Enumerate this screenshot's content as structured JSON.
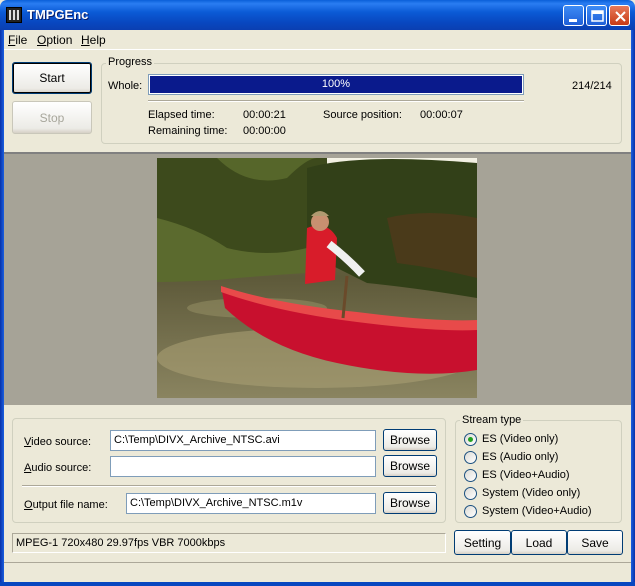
{
  "window": {
    "title": "TMPGEnc"
  },
  "menu": [
    {
      "label": "File",
      "underline": "F",
      "rest": "ile"
    },
    {
      "label": "Option",
      "underline": "O",
      "rest": "ption"
    },
    {
      "label": "Help",
      "underline": "H",
      "rest": "elp"
    }
  ],
  "controls": {
    "start_label": "Start",
    "stop_label": "Stop"
  },
  "progress": {
    "title": "Progress",
    "whole_label": "Whole:",
    "percent_text": "100%",
    "fraction": 1.0,
    "count": "214/214",
    "elapsed_label": "Elapsed time:",
    "elapsed_value": "00:00:21",
    "remaining_label": "Remaining time:",
    "remaining_value": "00:00:00",
    "source_pos_label": "Source position:",
    "source_pos_value": "00:00:07"
  },
  "sources": {
    "video_label_u": "V",
    "video_label_rest": "ideo source:",
    "video_value": "C:\\Temp\\DIVX_Archive_NTSC.avi",
    "audio_label_u": "A",
    "audio_label_rest": "udio source:",
    "audio_value": "",
    "output_label_u": "O",
    "output_label_rest": "utput file name:",
    "output_value": "C:\\Temp\\DIVX_Archive_NTSC.m1v",
    "browse_label": "Browse"
  },
  "stream_type": {
    "title": "Stream type",
    "options": [
      {
        "label": "ES (Video only)",
        "checked": true
      },
      {
        "label": "ES (Audio only)",
        "checked": false
      },
      {
        "label": "ES (Video+Audio)",
        "checked": false
      },
      {
        "label": "System (Video only)",
        "checked": false
      },
      {
        "label": "System (Video+Audio)",
        "checked": false
      }
    ]
  },
  "status": {
    "format_text": "MPEG-1 720x480 29.97fps VBR 7000kbps"
  },
  "bottom_buttons": {
    "setting_label": "Setting",
    "load_label": "Load",
    "save_label": "Save"
  },
  "colors": {
    "progress_fill": "#0a1a8c",
    "title_bar": "#0a5fd9"
  }
}
